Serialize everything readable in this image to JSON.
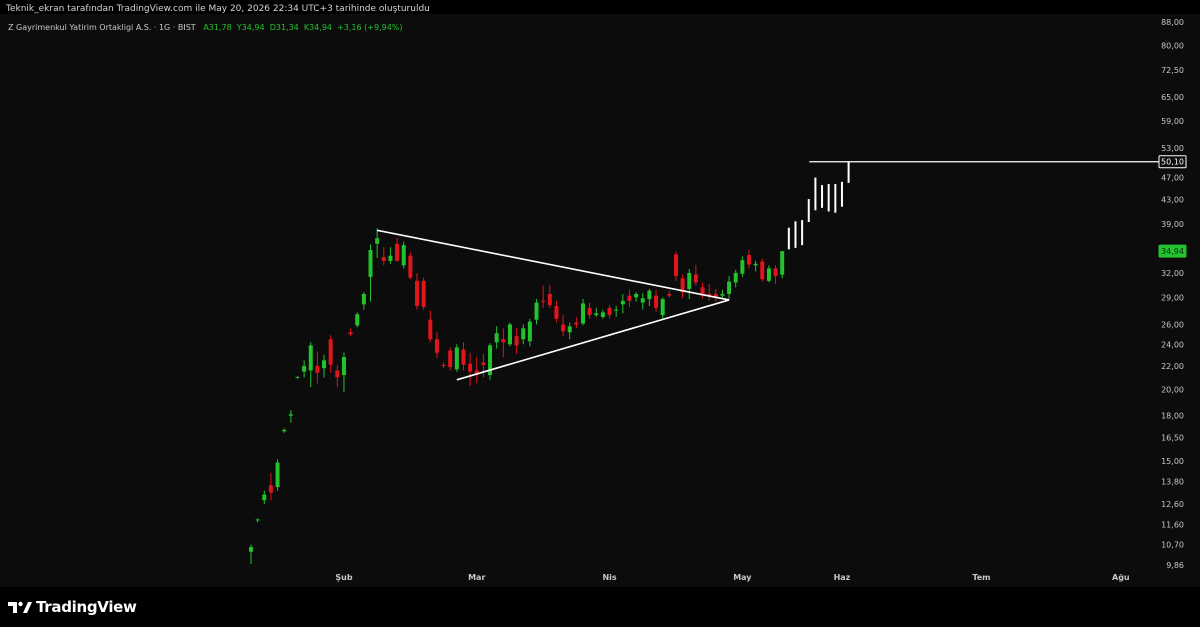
{
  "header": {
    "created_text": "Teknik_ekran tarafından TradingView.com ile May 20, 2026 22:34 UTC+3 tarihinde oluşturuldu"
  },
  "legend": {
    "symbol": "Z Gayrimenkul Yatirim Ortakligi A.S. · 1G · BIST",
    "open": "A31,78",
    "high": "Y34,94",
    "low": "D31,34",
    "close": "K34,94",
    "change": "+3,16 (+9,94%)"
  },
  "brand": {
    "name": "TradingView",
    "icon": "tradingview-logo-icon"
  },
  "colors": {
    "up": "#22c32e",
    "down": "#e0161c",
    "future": "#ffffff",
    "line": "#ffffff",
    "background": "#0c0c0c",
    "label_green": "#22c32e"
  },
  "chart_data": {
    "type": "candlestick",
    "scale": "log",
    "ylim": [
      9.5,
      88
    ],
    "yticks": [
      "88,00",
      "80,00",
      "72,50",
      "65,00",
      "59,00",
      "53,00",
      "47,00",
      "43,00",
      "39,00",
      "32,00",
      "29,00",
      "26,00",
      "24,00",
      "22,00",
      "20,00",
      "18,00",
      "16,50",
      "15,00",
      "13,80",
      "12,60",
      "11,60",
      "10,70",
      "9,86"
    ],
    "ytick_values": [
      88,
      80,
      72.5,
      65,
      59,
      53,
      47,
      43,
      39,
      32,
      29,
      26,
      24,
      22,
      20,
      18,
      16.5,
      15,
      13.8,
      12.6,
      11.6,
      10.7,
      9.86
    ],
    "xticks": [
      {
        "label": "Şub",
        "index": 14
      },
      {
        "label": "Mar",
        "index": 34
      },
      {
        "label": "Nis",
        "index": 54
      },
      {
        "label": "May",
        "index": 74
      },
      {
        "label": "Haz",
        "index": 89
      },
      {
        "label": "Tem",
        "index": 110
      },
      {
        "label": "Ağu",
        "index": 131
      }
    ],
    "price_labels": [
      {
        "value": 50.1,
        "text": "50,10",
        "style": "white"
      },
      {
        "value": 34.94,
        "text": "34,94",
        "style": "green"
      }
    ],
    "horizontal_line": {
      "value": 50.1,
      "from_index": 84
    },
    "trendlines": [
      {
        "from": {
          "index": 19,
          "price": 38.0
        },
        "to": {
          "index": 72,
          "price": 28.7
        }
      },
      {
        "from": {
          "index": 31,
          "price": 20.8
        },
        "to": {
          "index": 72,
          "price": 28.7
        }
      }
    ],
    "candles": [
      {
        "i": 0,
        "o": 10.4,
        "h": 10.7,
        "l": 9.9,
        "c": 10.6
      },
      {
        "i": 1,
        "o": 11.8,
        "h": 11.9,
        "l": 11.7,
        "c": 11.85
      },
      {
        "i": 2,
        "o": 12.8,
        "h": 13.3,
        "l": 12.6,
        "c": 13.1
      },
      {
        "i": 3,
        "o": 13.6,
        "h": 14.3,
        "l": 12.8,
        "c": 13.2
      },
      {
        "i": 4,
        "o": 13.5,
        "h": 15.1,
        "l": 13.3,
        "c": 14.9
      },
      {
        "i": 5,
        "o": 16.9,
        "h": 17.1,
        "l": 16.8,
        "c": 17.0
      },
      {
        "i": 6,
        "o": 18.0,
        "h": 18.4,
        "l": 17.5,
        "c": 18.1
      },
      {
        "i": 7,
        "o": 21.0,
        "h": 21.1,
        "l": 20.9,
        "c": 21.05
      },
      {
        "i": 8,
        "o": 21.5,
        "h": 22.5,
        "l": 21.0,
        "c": 22.0
      },
      {
        "i": 9,
        "o": 21.6,
        "h": 24.2,
        "l": 20.2,
        "c": 23.9
      },
      {
        "i": 10,
        "o": 22.0,
        "h": 23.3,
        "l": 20.5,
        "c": 21.4
      },
      {
        "i": 11,
        "o": 21.8,
        "h": 23.0,
        "l": 21.0,
        "c": 22.5
      },
      {
        "i": 12,
        "o": 24.5,
        "h": 24.9,
        "l": 21.4,
        "c": 22.1
      },
      {
        "i": 13,
        "o": 21.6,
        "h": 22.1,
        "l": 20.2,
        "c": 21.0
      },
      {
        "i": 14,
        "o": 21.2,
        "h": 23.2,
        "l": 19.8,
        "c": 22.8
      },
      {
        "i": 15,
        "o": 25.2,
        "h": 25.6,
        "l": 24.8,
        "c": 25.0
      },
      {
        "i": 16,
        "o": 25.9,
        "h": 27.3,
        "l": 25.7,
        "c": 27.1
      },
      {
        "i": 17,
        "o": 28.2,
        "h": 29.6,
        "l": 27.6,
        "c": 29.4
      },
      {
        "i": 18,
        "o": 31.5,
        "h": 35.9,
        "l": 28.5,
        "c": 35.1
      },
      {
        "i": 19,
        "o": 36.0,
        "h": 38.3,
        "l": 34.0,
        "c": 36.8
      },
      {
        "i": 20,
        "o": 34.1,
        "h": 35.5,
        "l": 33.0,
        "c": 33.6
      },
      {
        "i": 21,
        "o": 33.6,
        "h": 35.5,
        "l": 33.2,
        "c": 34.3
      },
      {
        "i": 22,
        "o": 36.0,
        "h": 36.8,
        "l": 33.5,
        "c": 33.6
      },
      {
        "i": 23,
        "o": 33.0,
        "h": 36.3,
        "l": 32.6,
        "c": 35.8
      },
      {
        "i": 24,
        "o": 34.3,
        "h": 34.8,
        "l": 31.2,
        "c": 31.4
      },
      {
        "i": 25,
        "o": 31.0,
        "h": 32.0,
        "l": 27.6,
        "c": 28.0
      },
      {
        "i": 26,
        "o": 31.0,
        "h": 31.4,
        "l": 27.6,
        "c": 27.9
      },
      {
        "i": 27,
        "o": 26.5,
        "h": 27.5,
        "l": 24.2,
        "c": 24.5
      },
      {
        "i": 28,
        "o": 24.5,
        "h": 25.2,
        "l": 22.7,
        "c": 23.2
      },
      {
        "i": 29,
        "o": 22.1,
        "h": 22.3,
        "l": 21.8,
        "c": 22.0
      },
      {
        "i": 30,
        "o": 23.4,
        "h": 23.7,
        "l": 21.6,
        "c": 21.9
      },
      {
        "i": 31,
        "o": 21.7,
        "h": 24.0,
        "l": 21.5,
        "c": 23.7
      },
      {
        "i": 32,
        "o": 23.5,
        "h": 24.2,
        "l": 21.6,
        "c": 22.1
      },
      {
        "i": 33,
        "o": 22.2,
        "h": 23.2,
        "l": 20.3,
        "c": 21.5
      },
      {
        "i": 34,
        "o": 21.6,
        "h": 22.8,
        "l": 20.5,
        "c": 21.2
      },
      {
        "i": 35,
        "o": 22.3,
        "h": 23.1,
        "l": 21.0,
        "c": 22.1
      },
      {
        "i": 36,
        "o": 21.2,
        "h": 24.1,
        "l": 20.8,
        "c": 23.9
      },
      {
        "i": 37,
        "o": 24.2,
        "h": 25.8,
        "l": 23.6,
        "c": 25.1
      },
      {
        "i": 38,
        "o": 24.5,
        "h": 25.6,
        "l": 22.8,
        "c": 24.2
      },
      {
        "i": 39,
        "o": 24.0,
        "h": 26.2,
        "l": 23.8,
        "c": 26.0
      },
      {
        "i": 40,
        "o": 24.8,
        "h": 25.6,
        "l": 23.1,
        "c": 23.9
      },
      {
        "i": 41,
        "o": 24.5,
        "h": 26.0,
        "l": 24.0,
        "c": 25.6
      },
      {
        "i": 42,
        "o": 24.3,
        "h": 26.6,
        "l": 23.8,
        "c": 26.3
      },
      {
        "i": 43,
        "o": 26.5,
        "h": 28.8,
        "l": 26.0,
        "c": 28.4
      },
      {
        "i": 44,
        "o": 28.6,
        "h": 30.4,
        "l": 27.8,
        "c": 28.5
      },
      {
        "i": 45,
        "o": 29.4,
        "h": 30.5,
        "l": 27.8,
        "c": 28.1
      },
      {
        "i": 46,
        "o": 28.0,
        "h": 28.6,
        "l": 26.2,
        "c": 26.6
      },
      {
        "i": 47,
        "o": 26.0,
        "h": 27.0,
        "l": 24.8,
        "c": 25.3
      },
      {
        "i": 48,
        "o": 25.2,
        "h": 26.2,
        "l": 24.5,
        "c": 25.8
      },
      {
        "i": 49,
        "o": 26.2,
        "h": 26.8,
        "l": 25.6,
        "c": 26.0
      },
      {
        "i": 50,
        "o": 26.1,
        "h": 28.8,
        "l": 25.9,
        "c": 28.3
      },
      {
        "i": 51,
        "o": 27.8,
        "h": 28.4,
        "l": 26.6,
        "c": 27.0
      },
      {
        "i": 52,
        "o": 27.0,
        "h": 27.8,
        "l": 26.8,
        "c": 27.2
      },
      {
        "i": 53,
        "o": 26.8,
        "h": 27.6,
        "l": 26.6,
        "c": 27.3
      },
      {
        "i": 54,
        "o": 27.8,
        "h": 28.1,
        "l": 26.6,
        "c": 27.0
      },
      {
        "i": 55,
        "o": 27.5,
        "h": 28.0,
        "l": 26.8,
        "c": 27.6
      },
      {
        "i": 56,
        "o": 28.2,
        "h": 29.4,
        "l": 27.2,
        "c": 28.6
      },
      {
        "i": 57,
        "o": 29.2,
        "h": 29.9,
        "l": 27.9,
        "c": 28.6
      },
      {
        "i": 58,
        "o": 29.0,
        "h": 29.6,
        "l": 28.5,
        "c": 29.4
      },
      {
        "i": 59,
        "o": 28.4,
        "h": 29.5,
        "l": 27.6,
        "c": 28.9
      },
      {
        "i": 60,
        "o": 28.8,
        "h": 30.0,
        "l": 28.0,
        "c": 29.8
      },
      {
        "i": 61,
        "o": 29.2,
        "h": 29.9,
        "l": 27.4,
        "c": 27.8
      },
      {
        "i": 62,
        "o": 27.0,
        "h": 29.0,
        "l": 26.6,
        "c": 28.8
      },
      {
        "i": 63,
        "o": 29.4,
        "h": 29.8,
        "l": 29.0,
        "c": 29.2
      },
      {
        "i": 64,
        "o": 34.5,
        "h": 34.9,
        "l": 31.0,
        "c": 31.6
      },
      {
        "i": 65,
        "o": 31.3,
        "h": 31.8,
        "l": 28.9,
        "c": 29.6
      },
      {
        "i": 66,
        "o": 30.0,
        "h": 32.5,
        "l": 28.8,
        "c": 32.0
      },
      {
        "i": 67,
        "o": 31.8,
        "h": 33.0,
        "l": 30.4,
        "c": 30.8
      },
      {
        "i": 68,
        "o": 30.2,
        "h": 30.8,
        "l": 28.9,
        "c": 29.2
      },
      {
        "i": 69,
        "o": 29.4,
        "h": 30.6,
        "l": 28.6,
        "c": 29.1
      },
      {
        "i": 70,
        "o": 29.4,
        "h": 30.0,
        "l": 28.5,
        "c": 29.0
      },
      {
        "i": 71,
        "o": 29.2,
        "h": 29.9,
        "l": 28.9,
        "c": 29.4
      },
      {
        "i": 72,
        "o": 29.4,
        "h": 31.6,
        "l": 28.7,
        "c": 30.9
      },
      {
        "i": 73,
        "o": 30.8,
        "h": 32.4,
        "l": 30.2,
        "c": 32.0
      },
      {
        "i": 74,
        "o": 31.9,
        "h": 34.2,
        "l": 31.5,
        "c": 33.7
      },
      {
        "i": 75,
        "o": 34.4,
        "h": 35.1,
        "l": 32.6,
        "c": 33.1
      },
      {
        "i": 76,
        "o": 33.0,
        "h": 33.6,
        "l": 32.2,
        "c": 33.2
      },
      {
        "i": 77,
        "o": 33.5,
        "h": 33.9,
        "l": 30.9,
        "c": 31.2
      },
      {
        "i": 78,
        "o": 31.0,
        "h": 33.0,
        "l": 30.8,
        "c": 32.6
      },
      {
        "i": 79,
        "o": 32.6,
        "h": 33.0,
        "l": 30.6,
        "c": 31.6
      },
      {
        "i": 80,
        "o": 31.78,
        "h": 34.94,
        "l": 31.34,
        "c": 34.94
      }
    ],
    "future_bars": [
      {
        "i": 81,
        "h": 38.4,
        "l": 35.2
      },
      {
        "i": 82,
        "h": 39.4,
        "l": 35.4
      },
      {
        "i": 83,
        "h": 39.6,
        "l": 35.8
      },
      {
        "i": 84,
        "h": 43.1,
        "l": 39.3
      },
      {
        "i": 85,
        "h": 47.0,
        "l": 41.2
      },
      {
        "i": 86,
        "h": 45.6,
        "l": 41.6
      },
      {
        "i": 87,
        "h": 45.8,
        "l": 41.0
      },
      {
        "i": 88,
        "h": 45.8,
        "l": 40.8
      },
      {
        "i": 89,
        "h": 46.2,
        "l": 41.8
      },
      {
        "i": 90,
        "h": 50.1,
        "l": 46.0
      }
    ]
  }
}
